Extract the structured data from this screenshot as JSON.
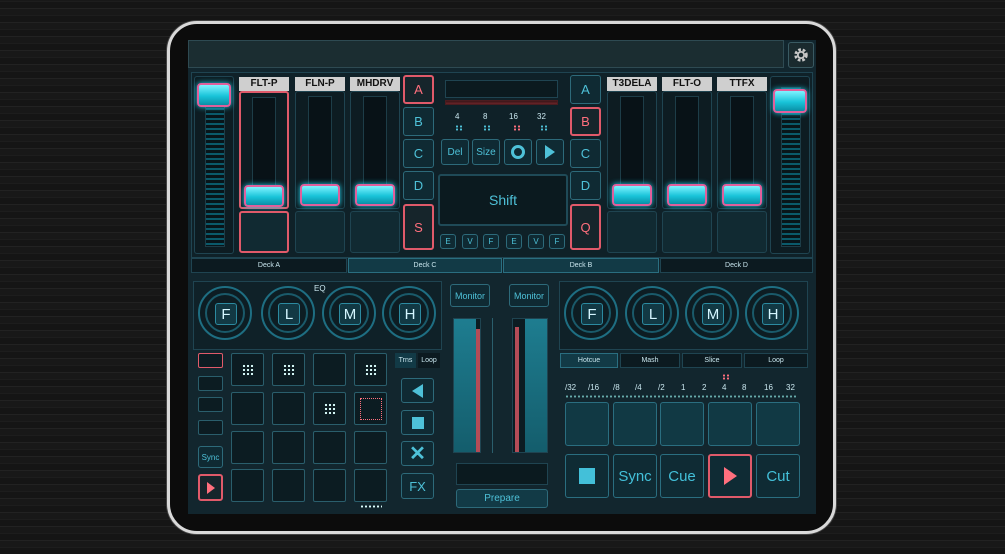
{
  "fx_labels_left": [
    "FLT-P",
    "FLN-P",
    "MHDRV"
  ],
  "fx_labels_right": [
    "T3DELA",
    "FLT-O",
    "TTFX"
  ],
  "deck_left_buttons": [
    "A",
    "B",
    "C",
    "D",
    "S"
  ],
  "deck_right_buttons": [
    "A",
    "B",
    "C",
    "D",
    "Q"
  ],
  "loop_sizes": [
    "4",
    "8",
    "16",
    "32"
  ],
  "center_buttons": {
    "del": "Del",
    "size": "Size"
  },
  "shift_label": "Shift",
  "efv_labels": [
    "E",
    "V",
    "F",
    "E",
    "V",
    "F"
  ],
  "deck_tabs": [
    "Deck A",
    "Deck C",
    "Deck B",
    "Deck D"
  ],
  "eq_label": "EQ",
  "knobs_left": [
    "F",
    "L",
    "M",
    "H"
  ],
  "knobs_right": [
    "F",
    "L",
    "M",
    "H"
  ],
  "monitor_labels": [
    "Monitor",
    "Monitor"
  ],
  "trns_tabs": [
    "Trns",
    "Loop"
  ],
  "sync_small": "Sync",
  "fx_button": "FX",
  "prepare_label": "Prepare",
  "mode_tabs": [
    "Hotcue",
    "Mash",
    "Slice",
    "Loop"
  ],
  "beat_divs": [
    "/32",
    "/16",
    "/8",
    "/4",
    "/2",
    "1",
    "2",
    "4",
    "8",
    "16",
    "32"
  ],
  "transport": {
    "sync": "Sync",
    "cue": "Cue",
    "cut": "Cut"
  },
  "colors": {
    "accent": "#19c4d9",
    "highlight": "#e05a6a",
    "knob_border": "#e0609c"
  }
}
